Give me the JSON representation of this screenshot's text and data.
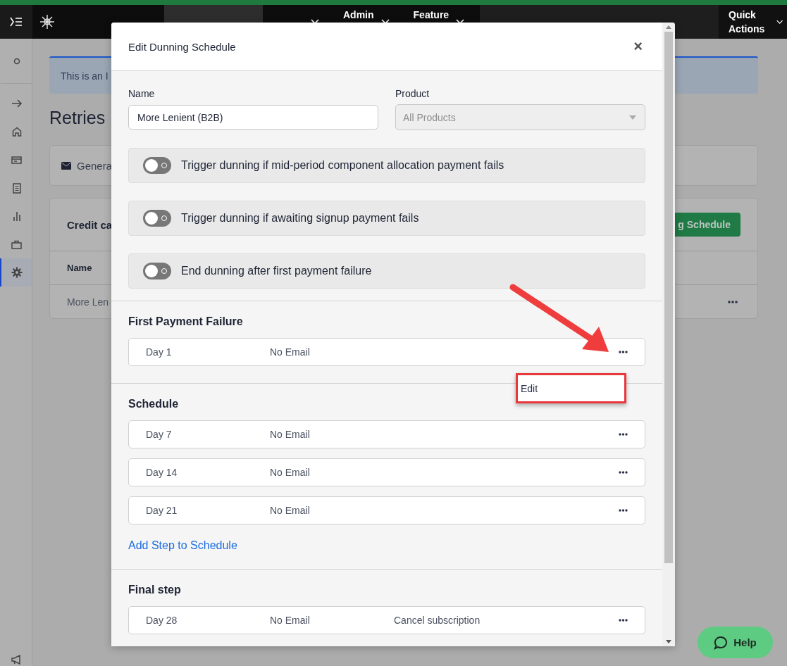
{
  "top_bar": {
    "nav": [
      {
        "selected": true,
        "dropdown": false
      },
      {
        "selected": false,
        "dropdown": true
      },
      {
        "label": "Admin",
        "selected": false,
        "dropdown": true
      },
      {
        "label": "Feature",
        "selected": false,
        "dropdown": true
      }
    ],
    "quick_actions": "Quick Actions"
  },
  "sidebar": {
    "items": [
      {
        "kind": "dot",
        "selected": false
      },
      {
        "kind": "arrow",
        "selected": false
      },
      {
        "kind": "home",
        "selected": false
      },
      {
        "kind": "card",
        "selected": false
      },
      {
        "kind": "document",
        "selected": false
      },
      {
        "kind": "chart",
        "selected": false
      },
      {
        "kind": "briefcase",
        "selected": false
      },
      {
        "kind": "gear",
        "selected": true
      }
    ],
    "bottom": {
      "kind": "megaphone"
    }
  },
  "page": {
    "banner": "This is an I",
    "title": "Retries",
    "tab": "Genera",
    "table": {
      "title": "Credit ca",
      "button": "g Schedule",
      "columns": [
        "Name"
      ],
      "rows": [
        {
          "name": "More Len"
        }
      ]
    }
  },
  "modal": {
    "title": "Edit Dunning Schedule",
    "close": "×",
    "name": {
      "label": "Name",
      "value": "More Lenient (B2B)"
    },
    "product": {
      "label": "Product",
      "placeholder": "All Products",
      "disabled": true
    },
    "toggles": [
      {
        "label": "Trigger dunning if mid-period component allocation payment fails",
        "on": false
      },
      {
        "label": "Trigger dunning if awaiting signup payment fails",
        "on": false
      },
      {
        "label": "End dunning after first payment failure",
        "on": false
      }
    ],
    "sections": [
      {
        "title": "First Payment Failure",
        "steps": [
          {
            "day": "Day 1",
            "email": "No Email"
          }
        ]
      },
      {
        "title": "Schedule",
        "steps": [
          {
            "day": "Day 7",
            "email": "No Email"
          },
          {
            "day": "Day 14",
            "email": "No Email"
          },
          {
            "day": "Day 21",
            "email": "No Email"
          }
        ],
        "add_link": "Add Step to Schedule"
      },
      {
        "title": "Final step",
        "steps": [
          {
            "day": "Day 28",
            "email": "No Email",
            "action": "Cancel subscription"
          }
        ]
      }
    ],
    "menu": {
      "items": [
        "Edit"
      ]
    }
  },
  "help": "Help"
}
